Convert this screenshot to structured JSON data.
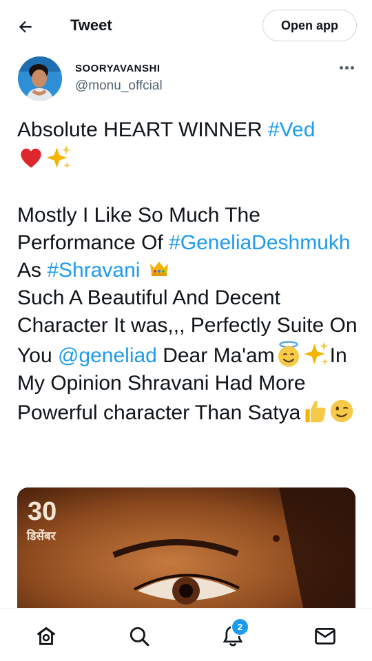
{
  "header": {
    "title": "Tweet",
    "back_icon": "arrow-left-icon",
    "open_app_label": "Open app"
  },
  "author": {
    "name": "SOORYAVANSHI",
    "handle": "@monu_offcial"
  },
  "tweet": {
    "line1_text": "Absolute HEART WINNER ",
    "hashtag_ved": "#Ved",
    "line2_emojis": [
      "heart-emoji",
      "sparkles-emoji"
    ],
    "line3_text": "Mostly I Like So Much The Performance Of ",
    "hashtag_genelia": "#GeneliaDeshmukh",
    "as_text": " As ",
    "hashtag_shravani": "#Shravani",
    "crown_emoji": "crown-emoji",
    "line4_text": "Such A Beautiful And Decent Character It was,,, Perfectly Suite On You ",
    "mention": "@geneliad",
    "line5_text": " Dear Ma'am",
    "line6_text": "In My Opinion Shravani Had More Powerful character Than Satya"
  },
  "media": {
    "date_number": "30",
    "date_month": "डिसेंबर"
  },
  "bottom_nav": {
    "items": [
      "home-icon",
      "search-icon",
      "notifications-icon",
      "messages-icon"
    ],
    "notification_count": "2"
  },
  "colors": {
    "accent": "#1d9bf0",
    "text": "#0f1419",
    "secondary_text": "#536471"
  }
}
